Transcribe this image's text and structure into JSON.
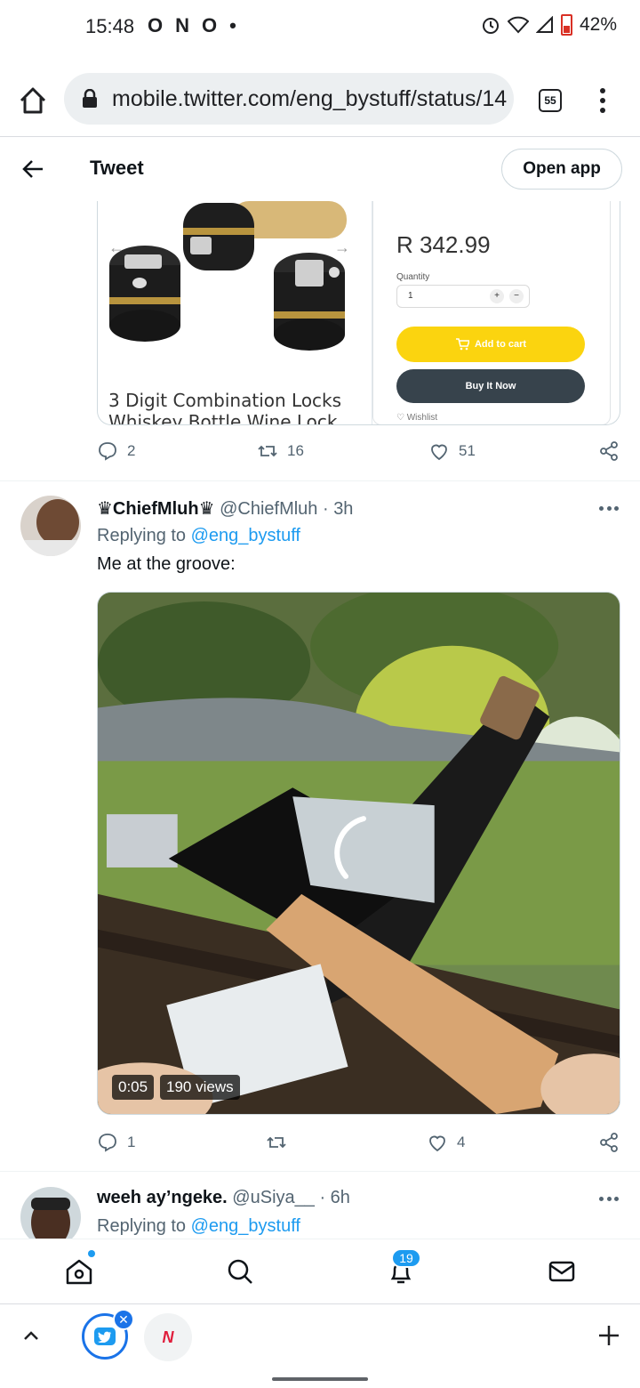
{
  "status_bar": {
    "time": "15:48",
    "notif_icons": [
      "O",
      "N",
      "O",
      "•"
    ],
    "battery": "42%"
  },
  "browser": {
    "url": "mobile.twitter.com/eng_bystuff/status/14",
    "tab_count": "55"
  },
  "tweet_header": {
    "title": "Tweet",
    "open_app": "Open app"
  },
  "product_card": {
    "caption_line1": "3 Digit Combination Locks",
    "caption_line2": "Whiskey Bottle Wine Lock",
    "price": "R 342.99",
    "quantity_label": "Quantity",
    "quantity_value": "1",
    "qty_plus": "+",
    "qty_minus": "−",
    "add_to_cart": "Add to cart",
    "buy_now": "Buy It Now",
    "wishlist": "♡ Wishlist"
  },
  "main_actions": {
    "replies": "2",
    "retweets": "16",
    "likes": "51"
  },
  "reply1": {
    "name": "♛ChiefMluh♛",
    "meta": " @ChiefMluh · 3h",
    "replying_prefix": "Replying to ",
    "replying_to": "@eng_bystuff",
    "text": "Me at the groove:",
    "video_time": "0:05",
    "video_views": "190 views",
    "replies": "1",
    "retweets": "",
    "likes": "4"
  },
  "reply2": {
    "name": "weeh ay’ngeke.",
    "meta": " @uSiya__ · 6h",
    "replying_prefix": "Replying to ",
    "replying_to": "@eng_bystuff"
  },
  "bottom_nav": {
    "notification_count": "19"
  },
  "colors": {
    "twitter_blue": "#1d9bf0",
    "cart_yellow": "#fbd40f",
    "buy_dark": "#37434c"
  }
}
